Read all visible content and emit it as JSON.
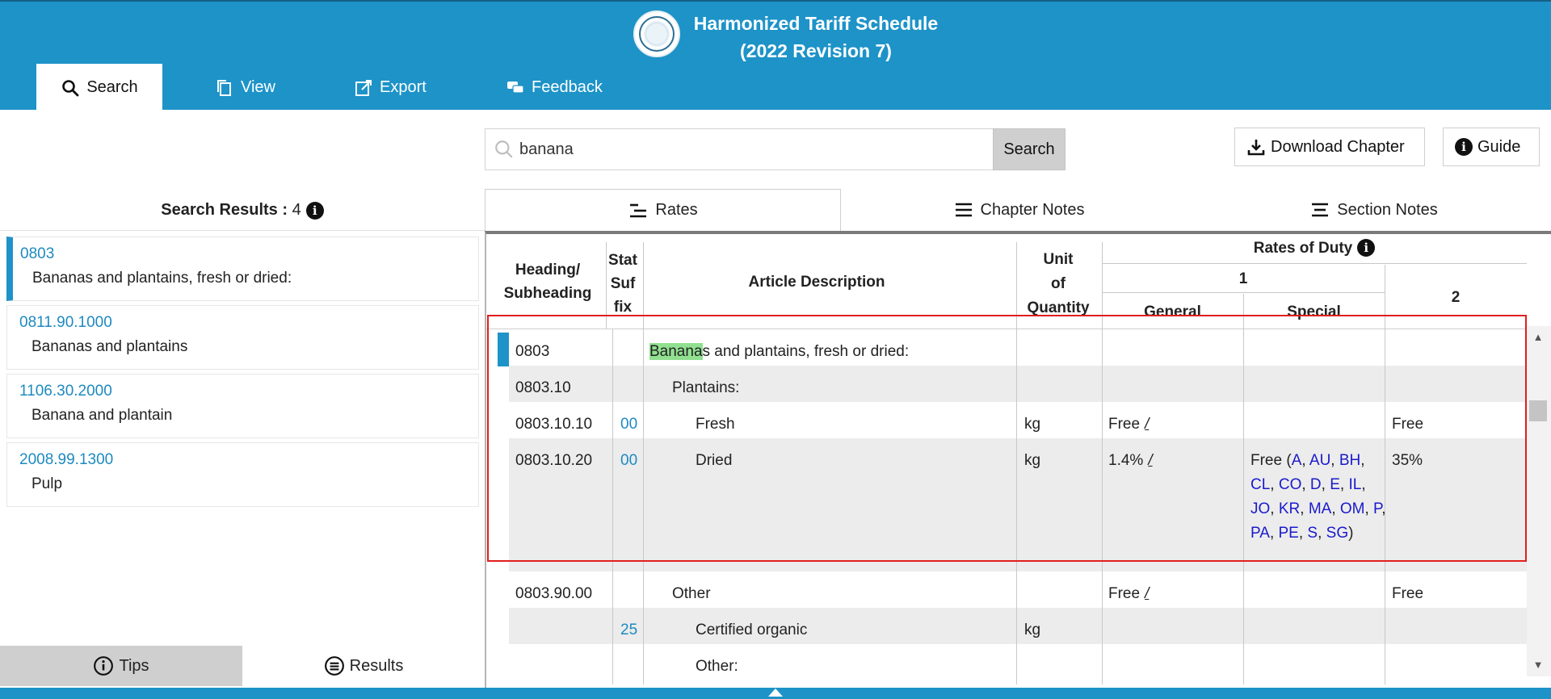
{
  "app": {
    "title_line1": "Harmonized Tariff Schedule",
    "title_line2": "(2022 Revision 7)"
  },
  "nav": [
    {
      "label": "Search",
      "icon": "search-icon",
      "active": true
    },
    {
      "label": "View",
      "icon": "view-icon"
    },
    {
      "label": "Export",
      "icon": "export-icon"
    },
    {
      "label": "Feedback",
      "icon": "feedback-icon"
    }
  ],
  "search": {
    "value": "banana",
    "button": "Search"
  },
  "actions": {
    "download": "Download Chapter",
    "guide": "Guide"
  },
  "results": {
    "label": "Search Results :",
    "count": "4",
    "items": [
      {
        "code": "0803",
        "desc": "Bananas and plantains, fresh or dried:"
      },
      {
        "code": "0811.90.1000",
        "desc": "Bananas and plantains"
      },
      {
        "code": "1106.30.2000",
        "desc": "Banana and plantain"
      },
      {
        "code": "2008.99.1300",
        "desc": "Pulp"
      }
    ]
  },
  "bottom_tabs": {
    "tips": "Tips",
    "results": "Results"
  },
  "content_tabs": {
    "rates": "Rates",
    "chapter_notes": "Chapter Notes",
    "section_notes": "Section Notes"
  },
  "table_head": {
    "heading": "Heading/\nSubheading",
    "stat": "Stat\nSuf\nfix",
    "article": "Article Description",
    "unit": "Unit\nof\nQuantity",
    "rates_of_duty": "Rates of Duty",
    "col1": "1",
    "general": "General",
    "special": "Special",
    "col2": "2"
  },
  "rows": [
    {
      "heading": "0803",
      "stat": "",
      "desc_hl": "Banana",
      "desc_rest": "s and plantains, fresh or dried:",
      "unit": "",
      "general": "",
      "general_mark": "",
      "special": "",
      "col2": ""
    },
    {
      "heading": "0803.10",
      "stat": "",
      "desc": "Plantains:",
      "unit": "",
      "general": "",
      "special": "",
      "col2": ""
    },
    {
      "heading": "0803.10.10",
      "stat": "00",
      "desc": "Fresh",
      "unit": "kg",
      "general": "Free",
      "general_mark": "/",
      "special": "",
      "col2": "Free"
    },
    {
      "heading": "0803.10.20",
      "stat": "00",
      "desc": "Dried",
      "unit": "kg",
      "general": "1.4%",
      "general_mark": "/",
      "special_prefix": "Free (",
      "special_codes": [
        "A",
        "AU",
        "BH",
        "CL",
        "CO",
        "D",
        "E",
        "IL",
        "JO",
        "KR",
        "MA",
        "OM",
        "P",
        "PA",
        "PE",
        "S",
        "SG"
      ],
      "special_suffix": ")",
      "col2": "35%"
    },
    {
      "heading": "0803.90.00",
      "stat": "",
      "desc": "Other",
      "unit": "",
      "general": "Free",
      "general_mark": "/",
      "special": "",
      "col2": "Free"
    },
    {
      "heading": "",
      "stat": "25",
      "desc": "Certified organic",
      "unit": "kg",
      "general": "",
      "special": "",
      "col2": ""
    },
    {
      "heading": "",
      "stat": "",
      "desc": "Other:",
      "unit": "",
      "general": "",
      "special": "",
      "col2": ""
    }
  ]
}
